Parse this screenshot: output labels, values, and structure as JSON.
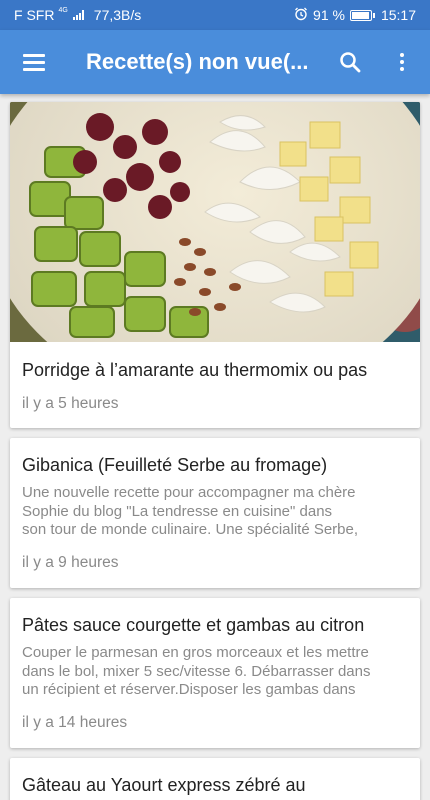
{
  "status_bar": {
    "carrier": "F SFR",
    "network": "4G",
    "speed": "77,3B/s",
    "battery": "91 %",
    "time": "15:17",
    "alarm_icon": "alarm-icon",
    "battery_icon": "battery-icon"
  },
  "app_bar": {
    "title": "Recette(s) non vue(...",
    "menu_icon": "menu-icon",
    "search_icon": "search-icon",
    "more_icon": "more-vert-icon",
    "color": "#4a8ddb"
  },
  "cards": [
    {
      "title": "Porridge à l’amarante au thermomix ou pas",
      "description": "",
      "time": "il y a 5 heures",
      "has_image": true
    },
    {
      "title": "Gibanica (Feuilleté Serbe au fromage)",
      "description_lines": [
        "Une nouvelle recette pour accompagner ma chère",
        "Sophie du blog \"La tendresse en cuisine\" dans",
        "son tour de monde culinaire. Une spécialité Serbe,"
      ],
      "time": "il y a 9 heures"
    },
    {
      "title": "Pâtes sauce courgette et gambas au citron",
      "description_lines": [
        "Couper le parmesan en gros morceaux et les mettre",
        "dans le bol, mixer 5 sec/vitesse 6. Débarrasser dans",
        "un récipient et réserver.Disposer les gambas dans"
      ],
      "time": "il y a 14 heures"
    },
    {
      "title": "Gâteau au Yaourt express zébré au",
      "description_lines": [],
      "time": ""
    }
  ]
}
